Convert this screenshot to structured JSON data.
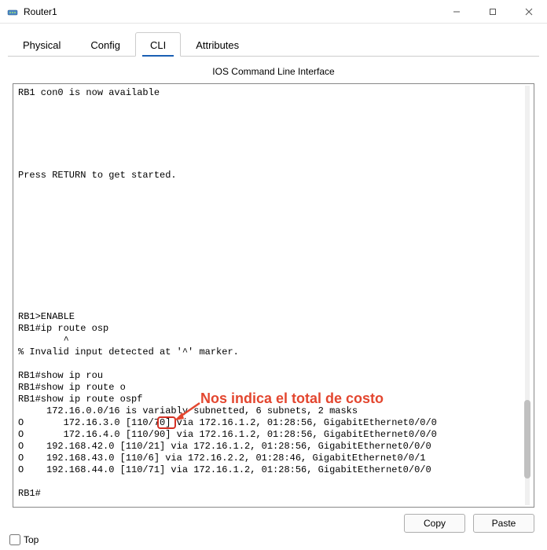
{
  "window": {
    "title": "Router1"
  },
  "tabs": {
    "physical": "Physical",
    "config": "Config",
    "cli": "CLI",
    "attributes": "Attributes"
  },
  "subtitle": "IOS Command Line Interface",
  "terminal_lines": [
    "RB1 con0 is now available",
    "",
    "",
    "",
    "",
    "",
    "",
    "Press RETURN to get started.",
    "",
    "",
    "",
    "",
    "",
    "",
    "",
    "",
    "",
    "",
    "",
    "RB1>ENABLE",
    "RB1#ip route osp",
    "        ^",
    "% Invalid input detected at '^' marker.",
    "",
    "RB1#show ip rou",
    "RB1#show ip route o",
    "RB1#show ip route ospf",
    "     172.16.0.0/16 is variably subnetted, 6 subnets, 2 masks",
    "O       172.16.3.0 [110/70] via 172.16.1.2, 01:28:56, GigabitEthernet0/0/0",
    "O       172.16.4.0 [110/90] via 172.16.1.2, 01:28:56, GigabitEthernet0/0/0",
    "O    192.168.42.0 [110/21] via 172.16.1.2, 01:28:56, GigabitEthernet0/0/0",
    "O    192.168.43.0 [110/6] via 172.16.2.2, 01:28:46, GigabitEthernet0/0/1",
    "O    192.168.44.0 [110/71] via 172.16.1.2, 01:28:56, GigabitEthernet0/0/0",
    "",
    "RB1#"
  ],
  "annotation": {
    "text": "Nos indica el total de costo",
    "highlighted_value": "70"
  },
  "buttons": {
    "copy": "Copy",
    "paste": "Paste"
  },
  "footer": {
    "top": "Top"
  }
}
